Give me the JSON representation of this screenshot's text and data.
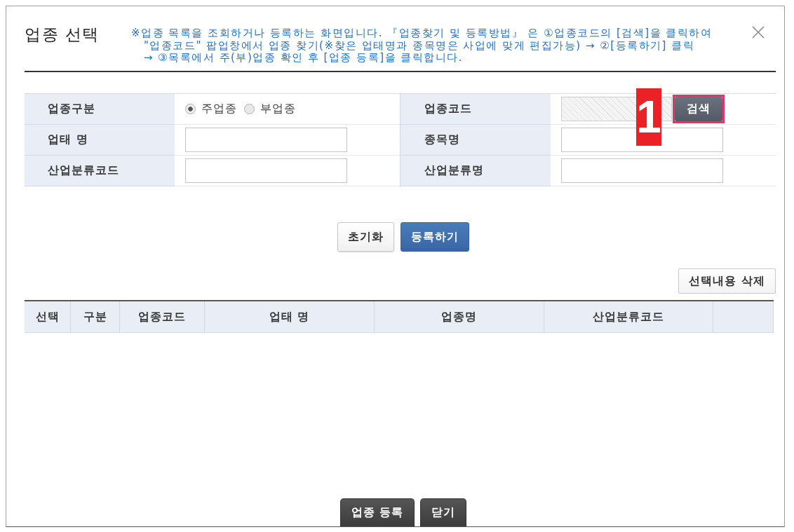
{
  "dialog": {
    "title": "업종 선택",
    "description_lines": [
      "※업종 목록을 조회하거나 등록하는 화면입니다. 『업종찾기 및 등록방법』 은 ①업종코드의 [검색]을 클릭하여",
      "\"업종코드\" 팝업창에서 업종 찾기(※찾은 업태명과 종목명은 사업에 맞게 편집가능) → ②[등록하기] 클릭",
      "→ ③목록에서 주(부)업종 확인 후 [업종 등록]을 클릭합니다."
    ]
  },
  "form": {
    "fields": [
      {
        "kind": "radio",
        "label": "업종구분",
        "options": [
          {
            "label": "주업종",
            "selected": true
          },
          {
            "label": "부업종",
            "selected": false
          }
        ]
      },
      {
        "kind": "lookup",
        "label": "업종코드",
        "disabled": true,
        "button": "검색",
        "highlighted": true,
        "callout": "1"
      },
      {
        "kind": "text",
        "label": "업태 명"
      },
      {
        "kind": "text",
        "label": "종목명"
      },
      {
        "kind": "text",
        "label": "산업분류코드"
      },
      {
        "kind": "text",
        "label": "산업분류명"
      }
    ]
  },
  "actions": [
    {
      "label": "초기화",
      "kind": "default"
    },
    {
      "label": "등록하기",
      "kind": "primary"
    }
  ],
  "delete_button": "선택내용 삭제",
  "table": {
    "columns": [
      "선택",
      "구분",
      "업종코드",
      "업태 명",
      "업종명",
      "산업분류코드"
    ]
  },
  "footer_buttons": [
    "업종 등록",
    "닫기"
  ]
}
